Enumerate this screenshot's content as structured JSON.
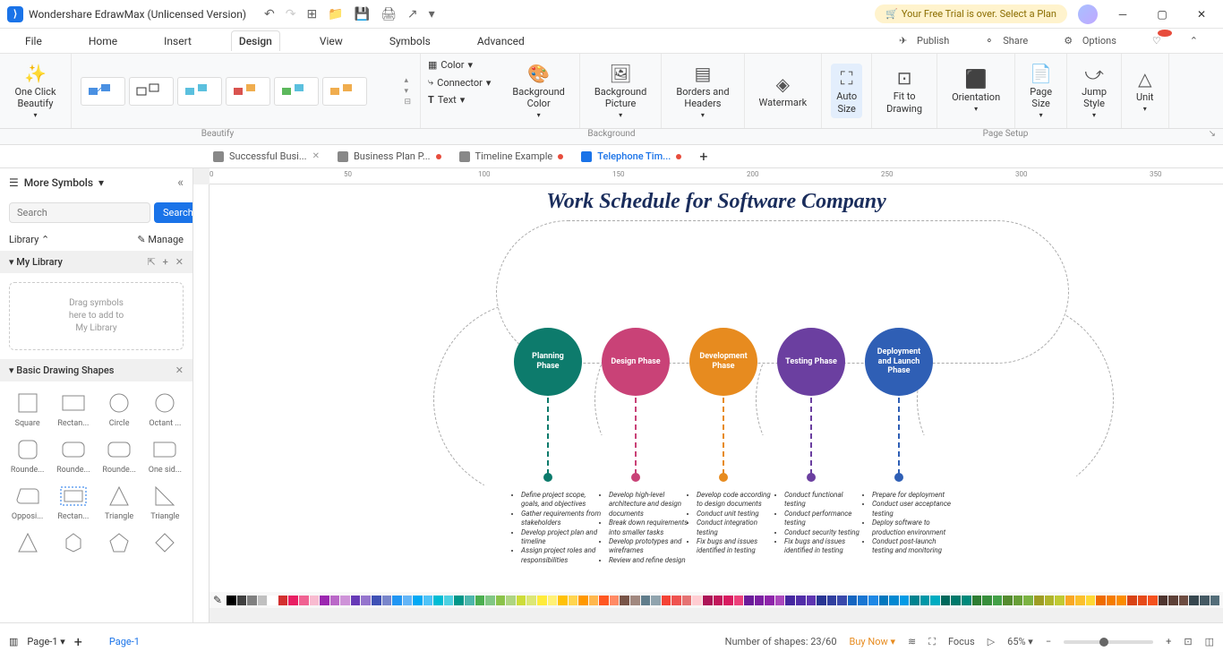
{
  "app": {
    "title": "Wondershare EdrawMax (Unlicensed Version)",
    "trial_msg": "Your Free Trial is over. Select a Plan"
  },
  "menu": {
    "items": [
      "File",
      "Home",
      "Insert",
      "Design",
      "View",
      "Symbols",
      "Advanced"
    ],
    "active": 3,
    "right": {
      "publish": "Publish",
      "share": "Share",
      "options": "Options"
    }
  },
  "ribbon": {
    "beautify": "One Click\nBeautify",
    "mini": {
      "color": "Color",
      "connector": "Connector",
      "text": "Text"
    },
    "bg_color": "Background\nColor",
    "bg_pic": "Background\nPicture",
    "borders": "Borders and\nHeaders",
    "watermark": "Watermark",
    "autosize": "Auto\nSize",
    "fit": "Fit to\nDrawing",
    "orient": "Orientation",
    "pagesize": "Page\nSize",
    "jump": "Jump\nStyle",
    "unit": "Unit",
    "groups": {
      "beautify": "Beautify",
      "background": "Background",
      "page_setup": "Page Setup"
    }
  },
  "tabs": [
    {
      "label": "Successful Busi...",
      "modified": false,
      "close": true
    },
    {
      "label": "Business Plan P...",
      "modified": true
    },
    {
      "label": "Timeline Example",
      "modified": true
    },
    {
      "label": "Telephone Tim...",
      "modified": true,
      "active": true
    }
  ],
  "sidebar": {
    "more": "More Symbols",
    "search_ph": "Search",
    "search_btn": "Search",
    "library": "Library",
    "manage": "Manage",
    "mylib": "My Library",
    "drop": "Drag symbols\nhere to add to\nMy Library",
    "basic": "Basic Drawing Shapes",
    "shapes": [
      "Square",
      "Rectan...",
      "Circle",
      "Octant ...",
      "Rounde...",
      "Rounde...",
      "Rounde...",
      "One sid...",
      "Opposi...",
      "Rectan...",
      "Triangle",
      "Triangle"
    ]
  },
  "canvas": {
    "title": "Work Schedule for Software Company",
    "phases": [
      {
        "name": "Planning\nPhase",
        "color": "#0d7b6c",
        "items": [
          "Define project scope, goals, and objectives",
          "Gather requirements from stakeholders",
          "Develop project plan and timeline",
          "Assign project roles and responsibilities"
        ]
      },
      {
        "name": "Design Phase",
        "color": "#c94277",
        "items": [
          "Develop high-level architecture and design documents",
          "Break down requirements into smaller tasks",
          "Develop prototypes and wireframes",
          "Review and refine design"
        ]
      },
      {
        "name": "Development\nPhase",
        "color": "#e78b1f",
        "items": [
          "Develop code according to design documents",
          "Conduct unit testing",
          "Conduct integration testing",
          "Fix bugs and issues identified in testing"
        ]
      },
      {
        "name": "Testing Phase",
        "color": "#6b3fa0",
        "items": [
          "Conduct functional testing",
          "Conduct performance testing",
          "Conduct security testing",
          "Fix bugs and issues identified in testing"
        ]
      },
      {
        "name": "Deployment\nand Launch\nPhase",
        "color": "#2f5fb5",
        "items": [
          "Prepare for deployment",
          "Conduct user acceptance testing",
          "Deploy software to production environment",
          "Conduct post-launch testing and monitoring"
        ]
      }
    ]
  },
  "colors": [
    "#000",
    "#404040",
    "#808080",
    "#c0c0c0",
    "#fff",
    "#d32f2f",
    "#e91e63",
    "#f06292",
    "#f8bbd0",
    "#9c27b0",
    "#ba68c8",
    "#ce93d8",
    "#673ab7",
    "#9575cd",
    "#3f51b5",
    "#7986cb",
    "#2196f3",
    "#64b5f6",
    "#03a9f4",
    "#4fc3f7",
    "#00bcd4",
    "#4dd0e1",
    "#009688",
    "#4db6ac",
    "#4caf50",
    "#81c784",
    "#8bc34a",
    "#aed581",
    "#cddc39",
    "#dce775",
    "#ffeb3b",
    "#fff176",
    "#ffc107",
    "#ffd54f",
    "#ff9800",
    "#ffb74d",
    "#ff5722",
    "#ff8a65",
    "#795548",
    "#a1887f",
    "#607d8b",
    "#90a4ae",
    "#f44336",
    "#ef5350",
    "#e57373",
    "#ffcdd2",
    "#ad1457",
    "#c2185b",
    "#d81b60",
    "#ec407a",
    "#6a1b9a",
    "#7b1fa2",
    "#8e24aa",
    "#ab47bc",
    "#4527a0",
    "#512da8",
    "#5e35b1",
    "#283593",
    "#303f9f",
    "#3949ab",
    "#1565c0",
    "#1976d2",
    "#1e88e5",
    "#0277bd",
    "#0288d1",
    "#039be5",
    "#00838f",
    "#0097a7",
    "#00acc1",
    "#00695c",
    "#00796b",
    "#00897b",
    "#2e7d32",
    "#388e3c",
    "#43a047",
    "#558b2f",
    "#689f38",
    "#7cb342",
    "#9e9d24",
    "#afb42b",
    "#c0ca33",
    "#f9a825",
    "#fbc02d",
    "#fdd835",
    "#ef6c00",
    "#f57c00",
    "#fb8c00",
    "#d84315",
    "#e64a19",
    "#f4511e",
    "#4e342e",
    "#5d4037",
    "#6d4c41",
    "#37474f",
    "#455a64",
    "#546e7a"
  ],
  "status": {
    "page": "Page-1",
    "page_bottom": "Page-1",
    "shapes": "Number of shapes: 23/60",
    "buy": "Buy Now",
    "focus": "Focus",
    "zoom": "65%"
  }
}
